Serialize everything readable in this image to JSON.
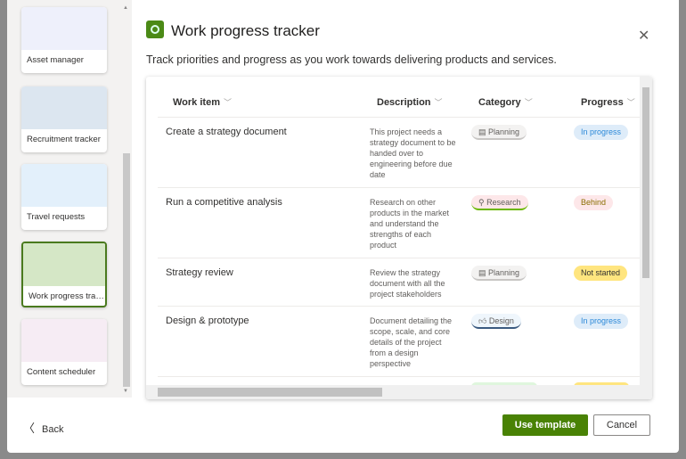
{
  "sidebar": {
    "templates": [
      {
        "label": "Asset manager"
      },
      {
        "label": "Recruitment tracker"
      },
      {
        "label": "Travel requests"
      },
      {
        "label": "Work progress tracker",
        "selected": true
      },
      {
        "label": "Content scheduler"
      }
    ]
  },
  "header": {
    "title": "Work progress tracker",
    "subtitle": "Track priorities and progress as you work towards delivering products and services.",
    "close_icon": "close-icon"
  },
  "table": {
    "columns": [
      "Work item",
      "Description",
      "Category",
      "Progress"
    ],
    "rows": [
      {
        "item": "Create a strategy document",
        "description": "This project needs a strategy document to be handed over to engineering before due date",
        "category": "Planning",
        "progress": "In progress"
      },
      {
        "item": "Run a competitive analysis",
        "description": "Research on other products in the market and understand the strengths of each product",
        "category": "Research",
        "progress": "Behind"
      },
      {
        "item": "Strategy review",
        "description": "Review the strategy document with all the project stakeholders",
        "category": "Planning",
        "progress": "Not started"
      },
      {
        "item": "Design & prototype",
        "description": "Document detailing the scope, scale, and core details of the project from a design perspective",
        "category": "Design",
        "progress": "In progress"
      }
    ]
  },
  "colors": {
    "accent": "#498205",
    "in_progress_bg": "#deecf9",
    "behind_bg": "#fde7e9",
    "not_started_bg": "#ffe57f"
  },
  "footer": {
    "back": "Back",
    "use_template": "Use template",
    "cancel": "Cancel"
  }
}
